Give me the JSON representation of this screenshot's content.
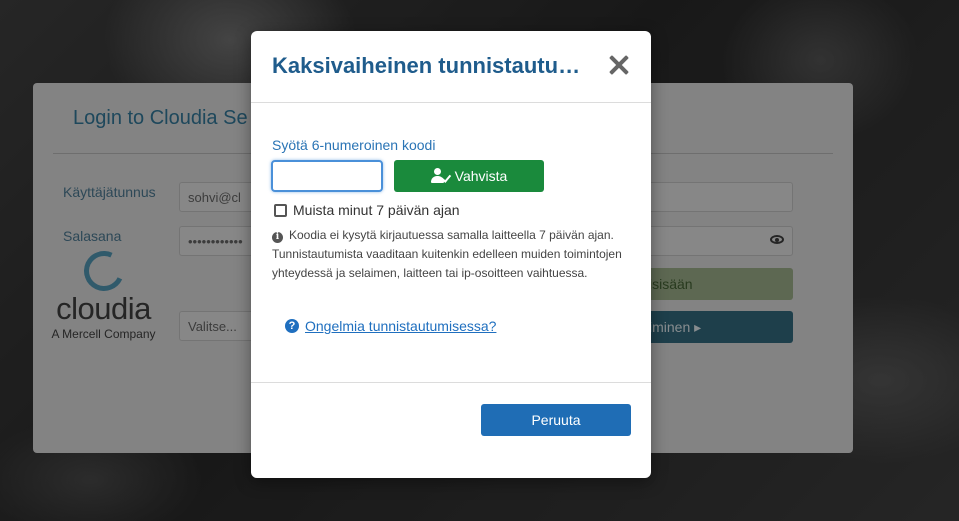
{
  "login": {
    "title": "Login to Cloudia Se",
    "username_label": "Käyttäjätunnus",
    "username_value": "sohvi@cl",
    "password_label": "Salasana",
    "password_value": "••••••••••••",
    "language_placeholder": "Valitse...",
    "login_button_label": "isisään",
    "next_button_label": "iminen ▸"
  },
  "logo": {
    "word": "cloudia",
    "sub": "A Mercell Company"
  },
  "modal": {
    "title": "Kaksivaiheinen tunnistautuminen",
    "code_label": "Syötä 6-numeroinen koodi",
    "code_value": "",
    "verify_label": "Vahvista",
    "remember_label": "Muista minut 7 päivän ajan",
    "remember_checked": false,
    "info_text": "Koodia ei kysytä kirjautuessa samalla laitteella 7 päivän ajan. Tunnistautumista vaaditaan kuitenkin edelleen muiden toimintojen yhteydessä ja selaimen, laitteen tai ip-osoitteen vaihtuessa.",
    "help_link": "Ongelmia tunnistautumisessa?",
    "cancel_label": "Peruuta"
  },
  "colors": {
    "title_blue": "#1f5c8c",
    "verify_green": "#1a8a3c",
    "cancel_blue": "#1f6db5",
    "link_blue": "#1f6fbf"
  }
}
